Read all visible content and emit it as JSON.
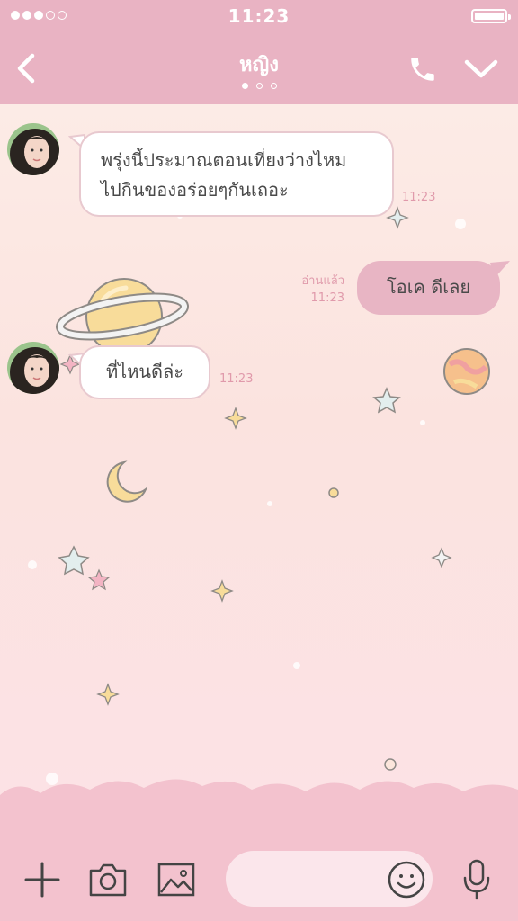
{
  "status_bar": {
    "time": "11:23",
    "signal_bars_filled": 3,
    "signal_bars_total": 5
  },
  "nav": {
    "back_icon": "chevron-left-icon",
    "title": "หญิง",
    "page_indicator": {
      "count": 3,
      "active_index": 0
    },
    "call_icon": "phone-icon",
    "menu_icon": "chevron-down-icon"
  },
  "messages": [
    {
      "direction": "incoming",
      "text": "พรุ่งนี้ประมาณตอนเที่ยงว่างไหม\nไปกินของอร่อยๆกันเถอะ",
      "time": "11:23"
    },
    {
      "direction": "outgoing",
      "text": "โอเค ดีเลย",
      "read_status": "อ่านแล้ว",
      "time": "11:23"
    },
    {
      "direction": "incoming",
      "text": "ที่ไหนดีล่ะ",
      "time": "11:23"
    }
  ],
  "toolbar": {
    "icons": [
      "plus-icon",
      "camera-icon",
      "image-icon",
      "emoji-icon",
      "microphone-icon"
    ],
    "input_placeholder": ""
  },
  "colors": {
    "header": "#e9b3c3",
    "incoming_bubble": "#ffffff",
    "outgoing_bubble": "#e8b5c4",
    "timestamp": "#e09aab",
    "background_top": "#fdeee8",
    "background_bottom": "#fce2e7"
  }
}
